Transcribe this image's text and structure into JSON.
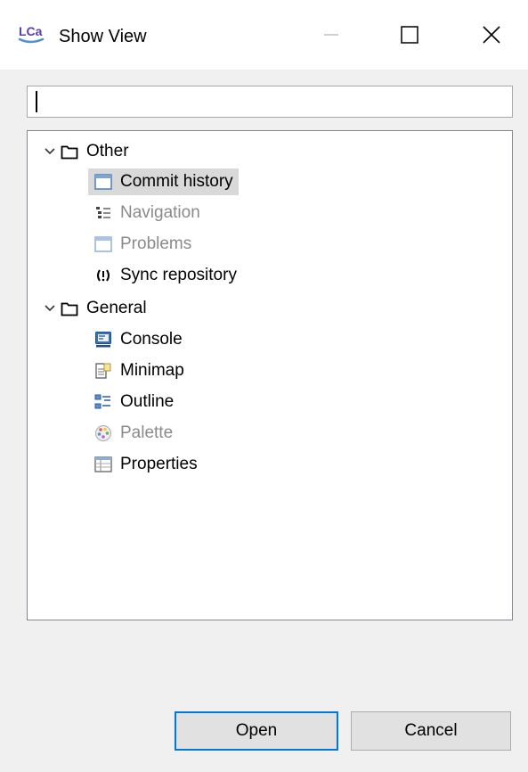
{
  "window": {
    "title": "Show View",
    "app_logo_text": "LCa",
    "controls": {
      "minimize": "minimize-icon",
      "maximize": "maximize-icon",
      "close": "close-icon"
    }
  },
  "filter": {
    "value": "",
    "placeholder": ""
  },
  "tree": {
    "groups": [
      {
        "label": "Other",
        "expanded": true,
        "items": [
          {
            "label": "Commit history",
            "icon": "view-window-icon",
            "selected": true,
            "enabled": true
          },
          {
            "label": "Navigation",
            "icon": "navigation-tree-icon",
            "selected": false,
            "enabled": false
          },
          {
            "label": "Problems",
            "icon": "view-window-icon",
            "selected": false,
            "enabled": false
          },
          {
            "label": "Sync repository",
            "icon": "sync-icon",
            "selected": false,
            "enabled": true
          }
        ]
      },
      {
        "label": "General",
        "expanded": true,
        "items": [
          {
            "label": "Console",
            "icon": "console-icon",
            "selected": false,
            "enabled": true
          },
          {
            "label": "Minimap",
            "icon": "minimap-icon",
            "selected": false,
            "enabled": true
          },
          {
            "label": "Outline",
            "icon": "outline-icon",
            "selected": false,
            "enabled": true
          },
          {
            "label": "Palette",
            "icon": "palette-icon",
            "selected": false,
            "enabled": false
          },
          {
            "label": "Properties",
            "icon": "properties-icon",
            "selected": false,
            "enabled": true
          }
        ]
      }
    ]
  },
  "buttons": {
    "open": "Open",
    "cancel": "Cancel"
  },
  "colors": {
    "accent": "#0078d7",
    "selection": "#d9d9d9",
    "disabled_text": "#8a8a8a"
  }
}
